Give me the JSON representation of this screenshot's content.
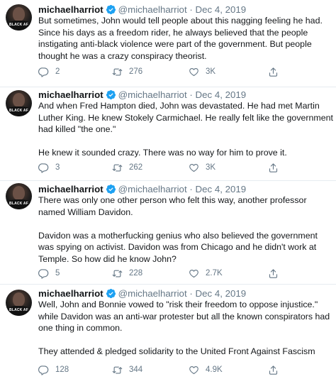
{
  "tweets": [
    {
      "name": "michaelharriot",
      "handle": "@michaelharriot",
      "separator": "·",
      "date": "Dec 4, 2019",
      "avatar_text": "BLACK AF",
      "paragraphs": [
        "But sometimes, John would tell people about this nagging feeling he had. Since his days as a freedom rider, he always believed that the people instigating anti-black violence were part of the government. But people thought he was a crazy conspiracy theorist."
      ],
      "replies": "2",
      "retweets": "276",
      "likes": "3K"
    },
    {
      "name": "michaelharriot",
      "handle": "@michaelharriot",
      "separator": "·",
      "date": "Dec 4, 2019",
      "avatar_text": "BLACK AF",
      "paragraphs": [
        "And when Fred Hampton died, John was devastated. He had met Martin Luther King. He knew Stokely Carmichael. He really  felt like the government had killed \"the one.\"",
        "He knew it sounded crazy. There was no way for him to prove it."
      ],
      "replies": "3",
      "retweets": "262",
      "likes": "3K"
    },
    {
      "name": "michaelharriot",
      "handle": "@michaelharriot",
      "separator": "·",
      "date": "Dec 4, 2019",
      "avatar_text": "BLACK AF",
      "paragraphs": [
        "There was only one other person who felt this way, another professor named William Davidon.",
        "Davidon was a motherfucking genius who also believed the government was spying on activist. Davidon was from Chicago and he didn't work at Temple. So how did he know John?"
      ],
      "replies": "5",
      "retweets": "228",
      "likes": "2.7K"
    },
    {
      "name": "michaelharriot",
      "handle": "@michaelharriot",
      "separator": "·",
      "date": "Dec 4, 2019",
      "avatar_text": "BLACK AF",
      "paragraphs": [
        "Well, John and Bonnie vowed to \"risk their freedom to oppose injustice.\" while Davidon was an anti-war protester but all the known conspirators had one thing in common.",
        "They attended & pledged solidarity to the United Front Against Fascism"
      ],
      "replies": "128",
      "retweets": "344",
      "likes": "4.9K"
    }
  ],
  "icons": {
    "verified": "verified-badge-icon",
    "reply": "reply-icon",
    "retweet": "retweet-icon",
    "like": "like-icon",
    "share": "share-icon"
  },
  "colors": {
    "verified": "#1da1f2",
    "text": "#14171a",
    "muted": "#657786",
    "divider": "#e6ecf0"
  }
}
